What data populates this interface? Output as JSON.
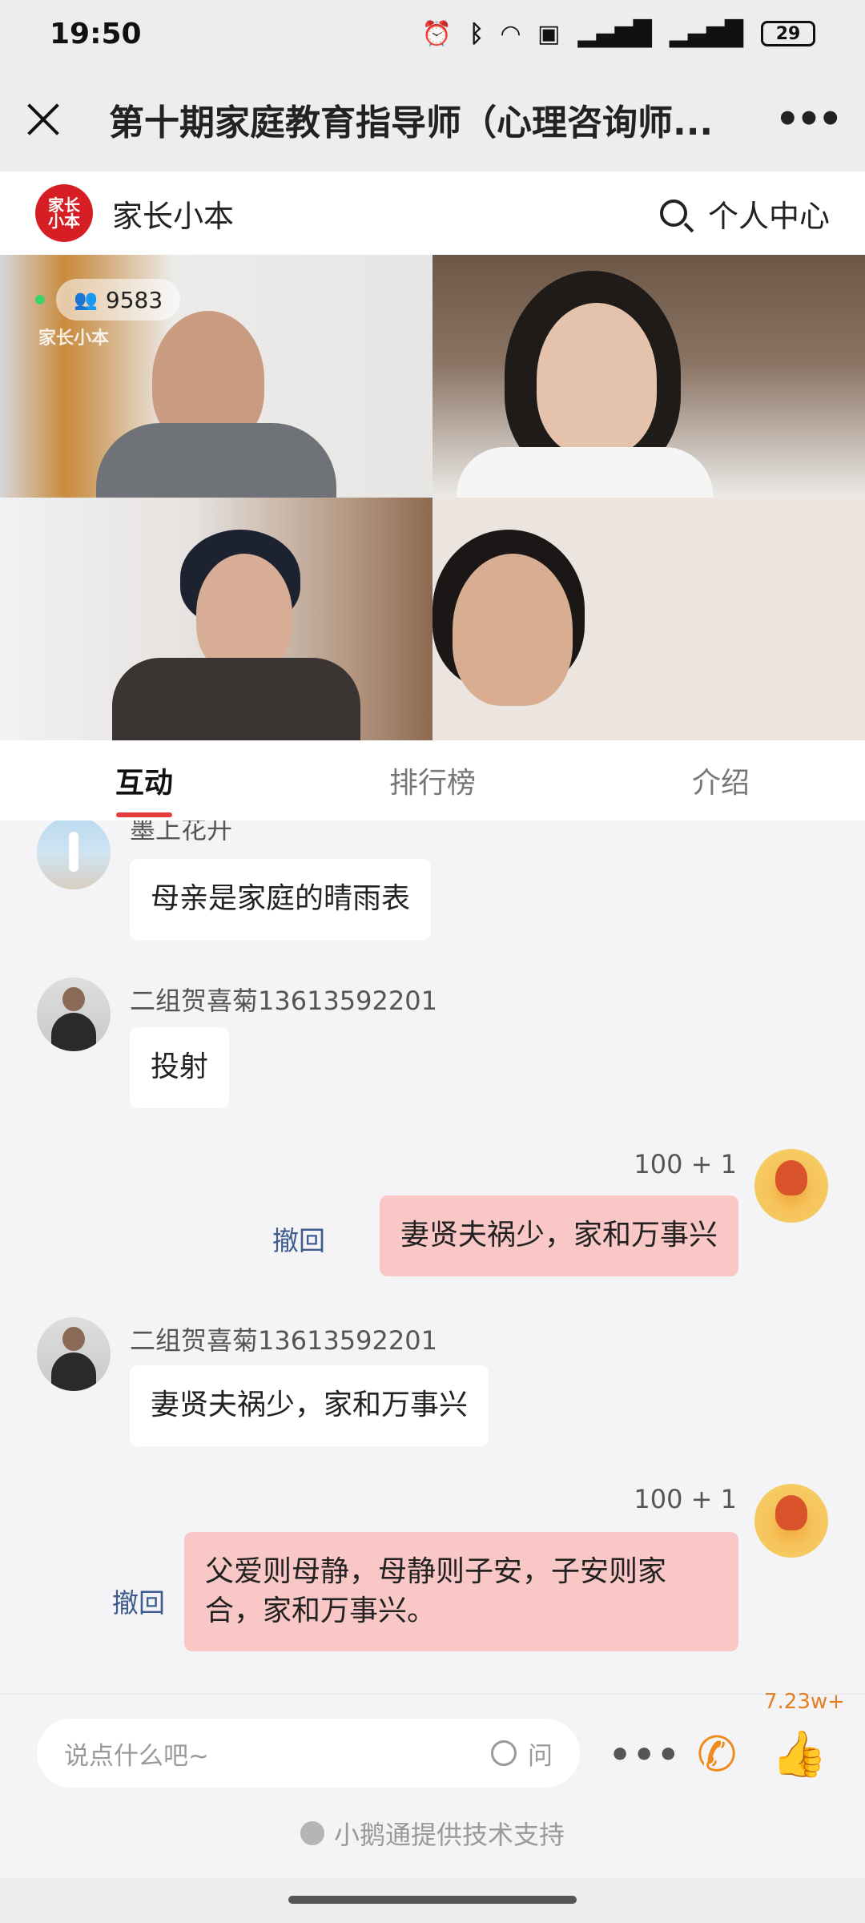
{
  "status": {
    "time": "19:50",
    "battery": "29",
    "icons": [
      "alarm-icon",
      "bluetooth-icon",
      "wifi-icon",
      "hd-icon",
      "signal-4g-icon",
      "signal-4g-icon"
    ]
  },
  "appbar": {
    "title": "第十期家庭教育指导师（心理咨询师...",
    "more": "•••"
  },
  "brand": {
    "logo_text": "家长小本",
    "name": "家长小本",
    "user_center": "个人中心"
  },
  "live": {
    "viewers": "9583",
    "watermark": "家长小本"
  },
  "tabs": [
    {
      "label": "互动",
      "active": true
    },
    {
      "label": "排行榜",
      "active": false
    },
    {
      "label": "介绍",
      "active": false
    }
  ],
  "messages": [
    {
      "nick": "墨上花开",
      "text": "母亲是家庭的晴雨表",
      "mine": false
    },
    {
      "nick": "二组贺喜菊13613592201",
      "text": "投射",
      "mine": false
    },
    {
      "nick": "100 + 1",
      "text": "妻贤夫祸少，家和万事兴",
      "mine": true,
      "recall": "撤回"
    },
    {
      "nick": "二组贺喜菊13613592201",
      "text": "妻贤夫祸少，家和万事兴",
      "mine": false
    },
    {
      "nick": "100 + 1",
      "text": "父爱则母静，母静则子安，子安则家合，家和万事兴。",
      "mine": true,
      "recall": "撤回"
    }
  ],
  "input": {
    "placeholder": "说点什么吧~",
    "ask_label": "问"
  },
  "likes": "7.23w+",
  "support_text": "小鹅通提供技术支持"
}
